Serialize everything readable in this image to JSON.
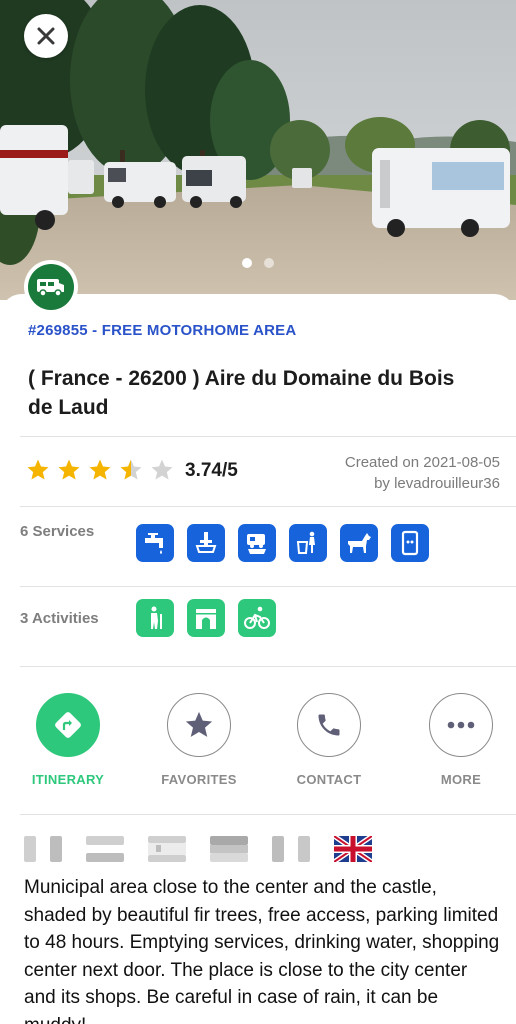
{
  "header": {
    "close_icon": "close-icon",
    "photo_alt": "Motorhomes parked on gravel area under fir trees",
    "carousel": {
      "count": 2,
      "active": 0
    }
  },
  "area": {
    "type_icon": "motorhome-icon",
    "type_color": "#1a7a3c",
    "id_label": "#269855 - FREE MOTORHOME AREA",
    "title": "( France - 26200 ) Aire du Domaine du Bois de Laud",
    "rating": {
      "value": 3.74,
      "text": "3.74/5",
      "stars": 5
    },
    "created_on": "Created on 2021-08-05",
    "created_by": "by levadrouilleur36"
  },
  "services": {
    "label": "6 Services",
    "items": [
      "water-tap-icon",
      "grey-water-drain-icon",
      "black-water-drain-icon",
      "trash-icon",
      "pets-allowed-icon",
      "electricity-icon"
    ],
    "color": "#1663dc"
  },
  "activities": {
    "label": "3 Activities",
    "items": [
      "hiking-icon",
      "monument-icon",
      "cycling-icon"
    ],
    "color": "#2ec87c"
  },
  "actions": [
    {
      "label": "ITINERARY",
      "icon": "directions-icon"
    },
    {
      "label": "FAVORITES",
      "icon": "star-icon"
    },
    {
      "label": "CONTACT",
      "icon": "phone-icon"
    },
    {
      "label": "MORE",
      "icon": "more-icon"
    }
  ],
  "languages": [
    "france-flag",
    "netherlands-flag",
    "spain-flag",
    "germany-flag",
    "italy-flag",
    "uk-flag"
  ],
  "description": "Municipal area close to the center and the castle, shaded by beautiful fir trees, free access, parking limited to 48 hours. Emptying services, drinking water, shopping center next door. The place is close to the city center and its shops. Be careful in case of rain, it can be muddy!"
}
